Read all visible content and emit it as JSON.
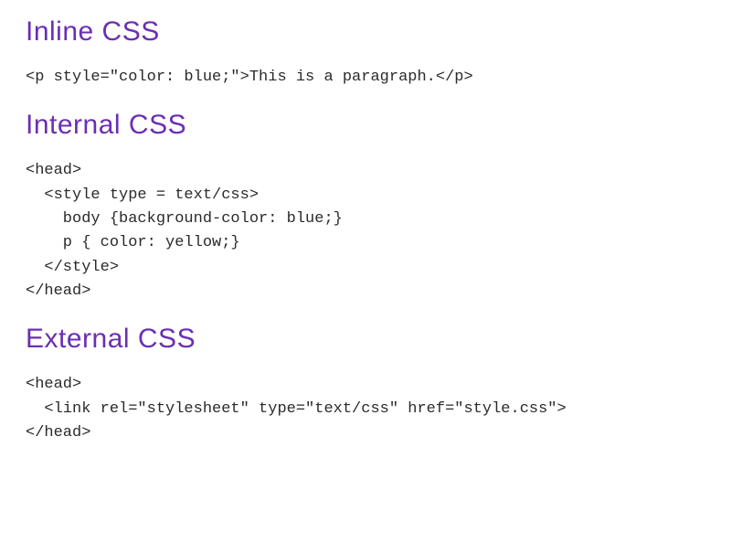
{
  "sections": {
    "inline": {
      "heading": "Inline CSS",
      "code": "<p style=\"color: blue;\">This is a paragraph.</p>"
    },
    "internal": {
      "heading": "Internal CSS",
      "code": "<head>\n  <style type = text/css>\n    body {background-color: blue;}\n    p { color: yellow;}\n  </style>\n</head>"
    },
    "external": {
      "heading": "External CSS",
      "code": "<head>\n  <link rel=\"stylesheet\" type=\"text/css\" href=\"style.css\">\n</head>"
    }
  }
}
